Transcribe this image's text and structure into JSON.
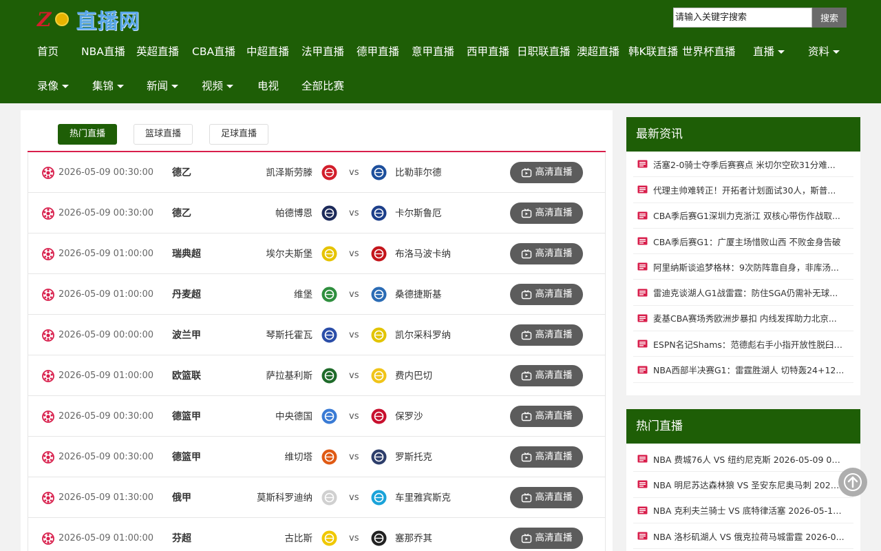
{
  "colors": {
    "header_bg": "#1e5e06",
    "accent_red": "#d81e4b",
    "live_button_bg": "#5c5c5c"
  },
  "header": {
    "logo": {
      "letter": "Z",
      "text": "直播网"
    },
    "search": {
      "placeholder": "请输入关键字搜索",
      "button_label": "搜索"
    },
    "nav_row1": [
      {
        "label": "首页",
        "has_caret": false
      },
      {
        "label": "NBA直播",
        "has_caret": false
      },
      {
        "label": "英超直播",
        "has_caret": false
      },
      {
        "label": "CBA直播",
        "has_caret": false
      },
      {
        "label": "中超直播",
        "has_caret": false
      },
      {
        "label": "法甲直播",
        "has_caret": false
      },
      {
        "label": "德甲直播",
        "has_caret": false
      },
      {
        "label": "意甲直播",
        "has_caret": false
      },
      {
        "label": "西甲直播",
        "has_caret": false
      },
      {
        "label": "日职联直播",
        "has_caret": false
      },
      {
        "label": "澳超直播",
        "has_caret": false
      },
      {
        "label": "韩K联直播",
        "has_caret": false
      },
      {
        "label": "世界杯直播",
        "has_caret": false
      },
      {
        "label": "直播",
        "has_caret": true
      },
      {
        "label": "资料",
        "has_caret": true
      }
    ],
    "nav_row2": [
      {
        "label": "录像",
        "has_caret": true
      },
      {
        "label": "集锦",
        "has_caret": true
      },
      {
        "label": "新闻",
        "has_caret": true
      },
      {
        "label": "视频",
        "has_caret": true
      },
      {
        "label": "电视",
        "has_caret": false
      },
      {
        "label": "全部比赛",
        "has_caret": false
      }
    ]
  },
  "tabs": [
    {
      "label": "热门直播",
      "active": true
    },
    {
      "label": "篮球直播",
      "active": false
    },
    {
      "label": "足球直播",
      "active": false
    }
  ],
  "live_button_label": "高清直播",
  "matches": [
    {
      "time": "2026-05-09 00:30:00",
      "league": "德乙",
      "home": "凯泽斯劳滕",
      "away": "比勒菲尔德",
      "home_color": "#d21e2b",
      "away_color": "#1d4f9c"
    },
    {
      "time": "2026-05-09 00:30:00",
      "league": "德乙",
      "home": "帕德博恩",
      "away": "卡尔斯鲁厄",
      "home_color": "#1c2a5a",
      "away_color": "#1d3f8a"
    },
    {
      "time": "2026-05-09 01:00:00",
      "league": "瑞典超",
      "home": "埃尔夫斯堡",
      "away": "布洛马波卡纳",
      "home_color": "#e6c300",
      "away_color": "#c4161c"
    },
    {
      "time": "2026-05-09 01:00:00",
      "league": "丹麦超",
      "home": "维堡",
      "away": "桑德捷斯基",
      "home_color": "#2f8f3e",
      "away_color": "#2b6cb5"
    },
    {
      "time": "2026-05-09 00:00:00",
      "league": "波兰甲",
      "home": "琴斯托霍瓦",
      "away": "凯尔采科罗纳",
      "home_color": "#2b4ea8",
      "away_color": "#e2c400"
    },
    {
      "time": "2026-05-09 01:00:00",
      "league": "欧篮联",
      "home": "萨拉基利斯",
      "away": "费内巴切",
      "home_color": "#1f6b2a",
      "away_color": "#f0c419"
    },
    {
      "time": "2026-05-09 00:30:00",
      "league": "德篮甲",
      "home": "中央德国",
      "away": "保罗沙",
      "home_color": "#3a7bd5",
      "away_color": "#c8102e"
    },
    {
      "time": "2026-05-09 00:30:00",
      "league": "德篮甲",
      "home": "维切塔",
      "away": "罗斯托克",
      "home_color": "#e05a14",
      "away_color": "#2d3e6b"
    },
    {
      "time": "2026-05-09 01:30:00",
      "league": "俄甲",
      "home": "莫斯科罗迪纳",
      "away": "车里雅宾斯克",
      "home_color": "#d0d0d0",
      "away_color": "#1aa3d9"
    },
    {
      "time": "2026-05-09 01:00:00",
      "league": "芬超",
      "home": "古比斯",
      "away": "塞那乔其",
      "home_color": "#f0c800",
      "away_color": "#222222"
    }
  ],
  "sidebar": {
    "news_title": "最新资讯",
    "news": [
      "活塞2-0骑士夺季后赛赛点 米切尔空砍31分难...",
      "代理主帅难转正！开拓者计划面试30人，斯普...",
      "CBA季后赛G1深圳力克浙江 双核心带伤作战取...",
      "CBA季后赛G1：广厦主场惜败山西 不败金身告破",
      "阿里纳斯谈追梦格林：9次防阵靠自身，非库汤...",
      "雷迪克谈湖人G1战雷霆：防住SGA仍需补无球...",
      "麦基CBA赛场秀欧洲步暴扣 内线发挥助力北京...",
      "ESPN名记Shams：范德彪右手小指开放性脱臼 ...",
      "NBA西部半决赛G1：雷霆胜湖人 切特轰24+12..."
    ],
    "hot_title": "热门直播",
    "hot": [
      "NBA 费城76人 VS 纽约尼克斯 2026-05-09 07:0...",
      "NBA 明尼苏达森林狼 VS 圣安东尼奥马刺 2026-...",
      "NBA 克利夫兰骑士 VS 底特律活塞 2026-05-10 ...",
      "NBA 洛杉矶湖人 VS 俄克拉荷马城雷霆 2026-0..."
    ]
  }
}
